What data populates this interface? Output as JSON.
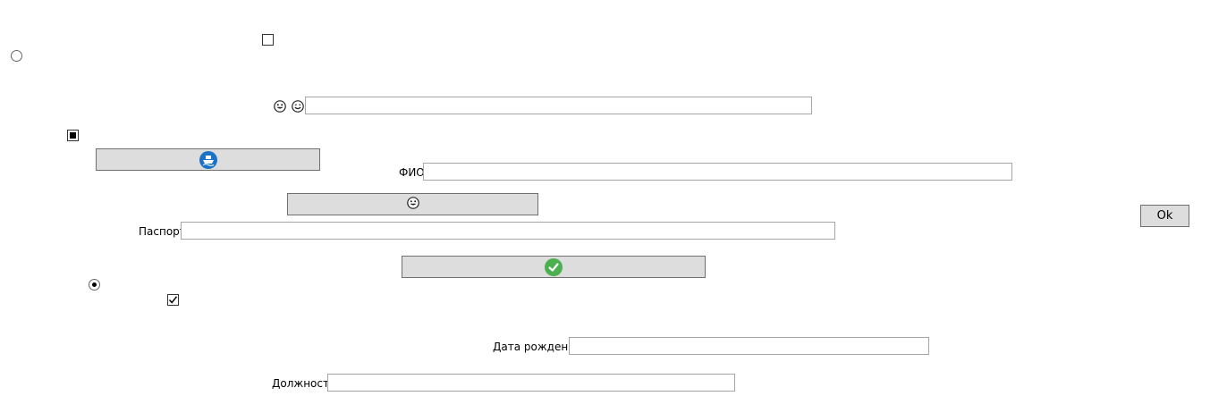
{
  "form": {
    "fio_label": "ФИО",
    "fio_value": "",
    "passport_label": "Паспорт",
    "passport_value": "",
    "birthdate_label": "Дата рождения",
    "birthdate_value": "",
    "position_label": "Должность",
    "position_value": "",
    "emoji_field_value": "",
    "ok_label": "Ok"
  },
  "controls": {
    "checkbox_top": {
      "state": "unchecked"
    },
    "checkbox_mid": {
      "state": "indeterminate"
    },
    "checkbox_bottom": {
      "state": "checked"
    },
    "radio_top": {
      "state": "unchecked"
    },
    "radio_bottom": {
      "state": "checked"
    }
  },
  "icons": {
    "emoji_pair": [
      "grinning-face-icon",
      "smiling-face-icon"
    ],
    "button_1": "ship-icon",
    "button_2": "grinning-face-icon",
    "button_3": "check-icon"
  },
  "colors": {
    "button_bg": "#dddddd",
    "ship_blue": "#1a73c7",
    "check_green": "#4caf50"
  }
}
